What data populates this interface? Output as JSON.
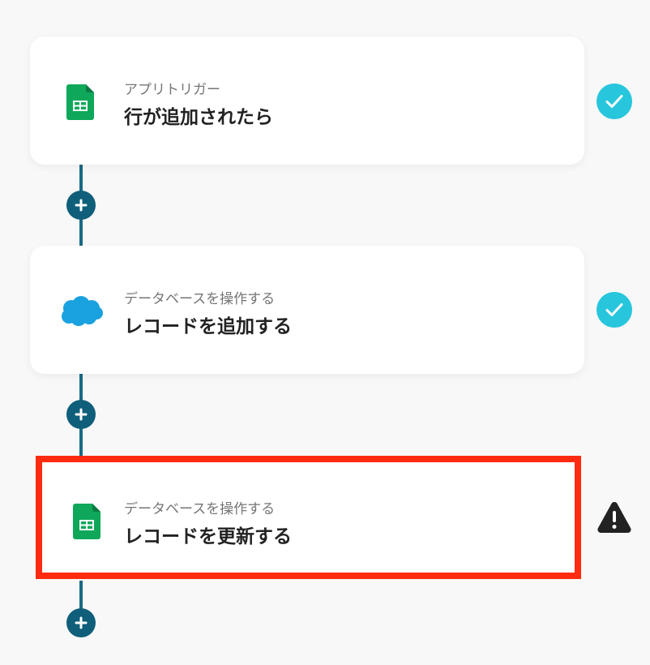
{
  "flow": {
    "steps": [
      {
        "category": "アプリトリガー",
        "title": "行が追加されたら",
        "app": "google-sheets-icon",
        "status": "complete"
      },
      {
        "category": "データベースを操作する",
        "title": "レコードを追加する",
        "app": "salesforce-icon",
        "status": "complete"
      },
      {
        "category": "データベースを操作する",
        "title": "レコードを更新する",
        "app": "google-sheets-icon",
        "status": "warning",
        "selected": true
      }
    ],
    "add_icon": "plus-icon"
  },
  "colors": {
    "connector": "#1a6a86",
    "add_button": "#0f5f7b",
    "check": "#27c6dc",
    "warning": "#222222",
    "selection": "#ff2b10",
    "sheets": "#0fa85a",
    "salesforce": "#1aa1e0"
  }
}
